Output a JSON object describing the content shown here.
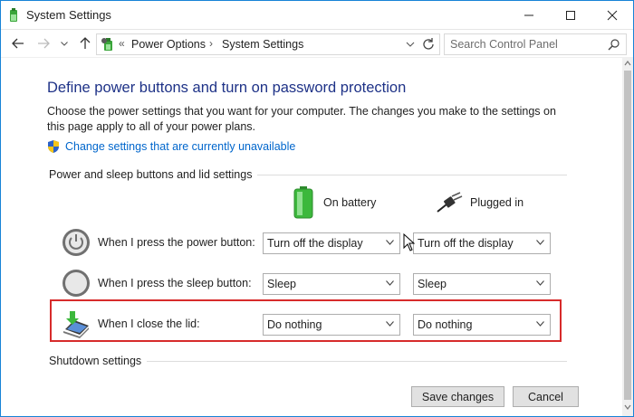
{
  "window": {
    "title": "System Settings"
  },
  "nav": {
    "breadcrumb_prefix": "«",
    "breadcrumbs": [
      "Power Options",
      "System Settings"
    ],
    "separator": "›",
    "search_placeholder": "Search Control Panel"
  },
  "main": {
    "title": "Define power buttons and turn on password protection",
    "description": "Choose the power settings that you want for your computer. The changes you make to the settings on this page apply to all of your power plans.",
    "uac_link": "Change settings that are currently unavailable",
    "section_power": "Power and sleep buttons and lid settings",
    "section_shutdown": "Shutdown settings",
    "columns": {
      "battery": "On battery",
      "plugged": "Plugged in"
    },
    "rows": [
      {
        "label": "When I press the power button:",
        "battery": "Turn off the display",
        "plugged": "Turn off the display",
        "icon": "power-button-icon"
      },
      {
        "label": "When I press the sleep button:",
        "battery": "Sleep",
        "plugged": "Sleep",
        "icon": "sleep-button-icon"
      },
      {
        "label": "When I close the lid:",
        "battery": "Do nothing",
        "plugged": "Do nothing",
        "icon": "laptop-lid-icon"
      }
    ]
  },
  "buttons": {
    "save": "Save changes",
    "cancel": "Cancel"
  },
  "colors": {
    "title_blue": "#1e3287",
    "link_blue": "#0066cc",
    "highlight_red": "#d72b2b",
    "window_border": "#1883d7"
  }
}
